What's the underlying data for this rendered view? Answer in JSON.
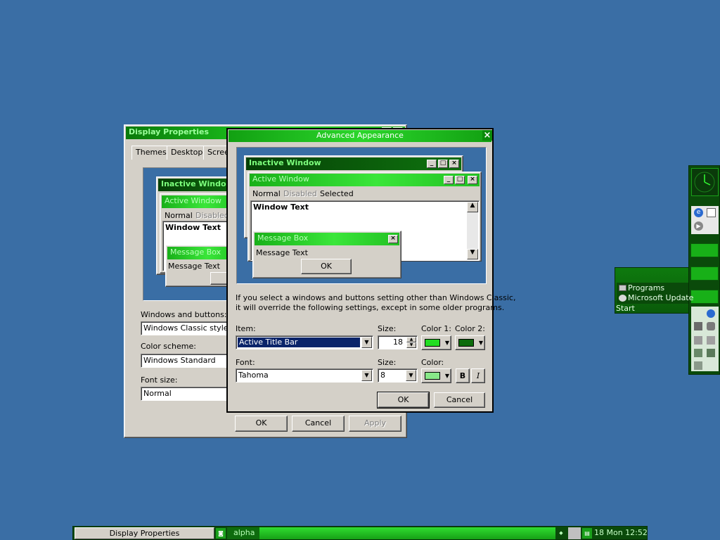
{
  "display_properties": {
    "title": "Display Properties",
    "tabs": [
      "Themes",
      "Desktop",
      "Scree"
    ],
    "preview": {
      "inactive_title": "Inactive Window",
      "active_title": "Active Window",
      "menu_normal": "Normal",
      "menu_disabled": "Disabled",
      "window_text": "Window Text",
      "msgbox_title": "Message Box",
      "msgbox_text": "Message Text"
    },
    "windows_buttons_label": "Windows and buttons:",
    "windows_buttons_value": "Windows Classic style",
    "color_scheme_label": "Color scheme:",
    "color_scheme_value": "Windows Standard",
    "font_size_label": "Font size:",
    "font_size_value": "Normal",
    "ok": "OK",
    "cancel": "Cancel",
    "apply": "Apply"
  },
  "advanced": {
    "title": "Advanced Appearance",
    "preview": {
      "inactive_title": "Inactive Window",
      "active_title": "Active Window",
      "menu_normal": "Normal",
      "menu_disabled": "Disabled",
      "menu_selected": "Selected",
      "window_text": "Window Text",
      "msgbox_title": "Message Box",
      "msgbox_text": "Message Text",
      "msgbox_ok": "OK"
    },
    "info_line1": "If you select a windows and buttons setting other than Windows Classic,",
    "info_line2": "it will override the following settings, except in some older programs.",
    "item_label": "Item:",
    "item_value": "Active Title Bar",
    "size_label": "Size:",
    "item_size": "18",
    "color1_label": "Color 1:",
    "color2_label": "Color 2:",
    "font_label": "Font:",
    "font_value": "Tahoma",
    "font_size_label": "Size:",
    "font_size": "8",
    "color_label": "Color:",
    "bold": "B",
    "italic": "I",
    "ok": "OK",
    "cancel": "Cancel",
    "colors": {
      "color1": "#22dd22",
      "color2": "#0b6b0b",
      "font_color": "#88e888"
    }
  },
  "side_menu": {
    "items": [
      "Programs",
      "Microsoft Update"
    ],
    "start": "Start"
  },
  "taskbar": {
    "task": "Display Properties",
    "workspace": "alpha",
    "clock": "18 Mon 12:52"
  },
  "theme": {
    "accent": "#22cc22",
    "desktop": "#3a6ea5"
  }
}
